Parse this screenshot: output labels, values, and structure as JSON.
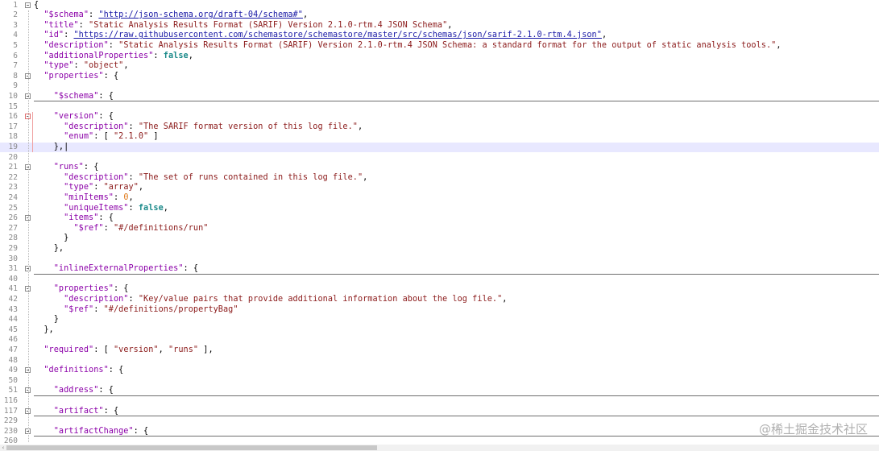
{
  "colors": {
    "key": "#8b00a8",
    "string": "#8b1a1a",
    "url": "#1a1aa6",
    "keyword": "#1b8a8a",
    "number": "#e07a1b",
    "current_line": "#e8e8ff"
  },
  "lines": [
    {
      "num": "1",
      "fold": true,
      "parts": [
        [
          "p",
          "{"
        ]
      ]
    },
    {
      "num": "2",
      "parts": [
        [
          "p",
          "  "
        ],
        [
          "k",
          "\"$schema\""
        ],
        [
          "p",
          ": "
        ],
        [
          "u",
          "\"http://json-schema.org/draft-04/schema#\""
        ],
        [
          "p",
          ","
        ]
      ]
    },
    {
      "num": "3",
      "parts": [
        [
          "p",
          "  "
        ],
        [
          "k",
          "\"title\""
        ],
        [
          "p",
          ": "
        ],
        [
          "s",
          "\"Static Analysis Results Format (SARIF) Version 2.1.0-rtm.4 JSON Schema\""
        ],
        [
          "p",
          ","
        ]
      ]
    },
    {
      "num": "4",
      "parts": [
        [
          "p",
          "  "
        ],
        [
          "k",
          "\"id\""
        ],
        [
          "p",
          ": "
        ],
        [
          "u",
          "\"https://raw.githubusercontent.com/schemastore/schemastore/master/src/schemas/json/sarif-2.1.0-rtm.4.json\""
        ],
        [
          "p",
          ","
        ]
      ]
    },
    {
      "num": "5",
      "parts": [
        [
          "p",
          "  "
        ],
        [
          "k",
          "\"description\""
        ],
        [
          "p",
          ": "
        ],
        [
          "s",
          "\"Static Analysis Results Format (SARIF) Version 2.1.0-rtm.4 JSON Schema: a standard format for the output of static analysis tools.\""
        ],
        [
          "p",
          ","
        ]
      ]
    },
    {
      "num": "6",
      "parts": [
        [
          "p",
          "  "
        ],
        [
          "k",
          "\"additionalProperties\""
        ],
        [
          "p",
          ": "
        ],
        [
          "b",
          "false"
        ],
        [
          "p",
          ","
        ]
      ]
    },
    {
      "num": "7",
      "parts": [
        [
          "p",
          "  "
        ],
        [
          "k",
          "\"type\""
        ],
        [
          "p",
          ": "
        ],
        [
          "s",
          "\"object\""
        ],
        [
          "p",
          ","
        ]
      ]
    },
    {
      "num": "8",
      "fold": true,
      "parts": [
        [
          "p",
          "  "
        ],
        [
          "k",
          "\"properties\""
        ],
        [
          "p",
          ": {"
        ]
      ]
    },
    {
      "num": "9",
      "parts": []
    },
    {
      "num": "10",
      "fold": true,
      "collapsed": true,
      "parts": [
        [
          "p",
          "    "
        ],
        [
          "k",
          "\"$schema\""
        ],
        [
          "p",
          ": {"
        ]
      ]
    },
    {
      "num": "15",
      "parts": []
    },
    {
      "num": "16",
      "fold": true,
      "mod": true,
      "parts": [
        [
          "p",
          "    "
        ],
        [
          "k",
          "\"version\""
        ],
        [
          "p",
          ": {"
        ]
      ]
    },
    {
      "num": "17",
      "parts": [
        [
          "p",
          "      "
        ],
        [
          "k",
          "\"description\""
        ],
        [
          "p",
          ": "
        ],
        [
          "s",
          "\"The SARIF format version of this log file.\""
        ],
        [
          "p",
          ","
        ]
      ]
    },
    {
      "num": "18",
      "parts": [
        [
          "p",
          "      "
        ],
        [
          "k",
          "\"enum\""
        ],
        [
          "p",
          ": [ "
        ],
        [
          "s",
          "\"2.1.0\""
        ],
        [
          "p",
          " ]"
        ]
      ]
    },
    {
      "num": "19",
      "highlight": true,
      "parts": [
        [
          "p",
          "    },|"
        ]
      ]
    },
    {
      "num": "20",
      "parts": []
    },
    {
      "num": "21",
      "fold": true,
      "parts": [
        [
          "p",
          "    "
        ],
        [
          "k",
          "\"runs\""
        ],
        [
          "p",
          ": {"
        ]
      ]
    },
    {
      "num": "22",
      "parts": [
        [
          "p",
          "      "
        ],
        [
          "k",
          "\"description\""
        ],
        [
          "p",
          ": "
        ],
        [
          "s",
          "\"The set of runs contained in this log file.\""
        ],
        [
          "p",
          ","
        ]
      ]
    },
    {
      "num": "23",
      "parts": [
        [
          "p",
          "      "
        ],
        [
          "k",
          "\"type\""
        ],
        [
          "p",
          ": "
        ],
        [
          "s",
          "\"array\""
        ],
        [
          "p",
          ","
        ]
      ]
    },
    {
      "num": "24",
      "parts": [
        [
          "p",
          "      "
        ],
        [
          "k",
          "\"minItems\""
        ],
        [
          "p",
          ": "
        ],
        [
          "n",
          "0"
        ],
        [
          "p",
          ","
        ]
      ]
    },
    {
      "num": "25",
      "parts": [
        [
          "p",
          "      "
        ],
        [
          "k",
          "\"uniqueItems\""
        ],
        [
          "p",
          ": "
        ],
        [
          "b",
          "false"
        ],
        [
          "p",
          ","
        ]
      ]
    },
    {
      "num": "26",
      "fold": true,
      "parts": [
        [
          "p",
          "      "
        ],
        [
          "k",
          "\"items\""
        ],
        [
          "p",
          ": {"
        ]
      ]
    },
    {
      "num": "27",
      "parts": [
        [
          "p",
          "        "
        ],
        [
          "k",
          "\"$ref\""
        ],
        [
          "p",
          ": "
        ],
        [
          "s",
          "\"#/definitions/run\""
        ]
      ]
    },
    {
      "num": "28",
      "parts": [
        [
          "p",
          "      }"
        ]
      ]
    },
    {
      "num": "29",
      "parts": [
        [
          "p",
          "    },"
        ]
      ]
    },
    {
      "num": "30",
      "parts": []
    },
    {
      "num": "31",
      "fold": true,
      "collapsed": true,
      "parts": [
        [
          "p",
          "    "
        ],
        [
          "k",
          "\"inlineExternalProperties\""
        ],
        [
          "p",
          ": {"
        ]
      ]
    },
    {
      "num": "40",
      "parts": []
    },
    {
      "num": "41",
      "fold": true,
      "parts": [
        [
          "p",
          "    "
        ],
        [
          "k",
          "\"properties\""
        ],
        [
          "p",
          ": {"
        ]
      ]
    },
    {
      "num": "42",
      "parts": [
        [
          "p",
          "      "
        ],
        [
          "k",
          "\"description\""
        ],
        [
          "p",
          ": "
        ],
        [
          "s",
          "\"Key/value pairs that provide additional information about the log file.\""
        ],
        [
          "p",
          ","
        ]
      ]
    },
    {
      "num": "43",
      "parts": [
        [
          "p",
          "      "
        ],
        [
          "k",
          "\"$ref\""
        ],
        [
          "p",
          ": "
        ],
        [
          "s",
          "\"#/definitions/propertyBag\""
        ]
      ]
    },
    {
      "num": "44",
      "parts": [
        [
          "p",
          "    }"
        ]
      ]
    },
    {
      "num": "45",
      "parts": [
        [
          "p",
          "  },"
        ]
      ]
    },
    {
      "num": "46",
      "parts": []
    },
    {
      "num": "47",
      "parts": [
        [
          "p",
          "  "
        ],
        [
          "k",
          "\"required\""
        ],
        [
          "p",
          ": [ "
        ],
        [
          "s",
          "\"version\""
        ],
        [
          "p",
          ", "
        ],
        [
          "s",
          "\"runs\""
        ],
        [
          "p",
          " ],"
        ]
      ]
    },
    {
      "num": "48",
      "parts": []
    },
    {
      "num": "49",
      "fold": true,
      "parts": [
        [
          "p",
          "  "
        ],
        [
          "k",
          "\"definitions\""
        ],
        [
          "p",
          ": {"
        ]
      ]
    },
    {
      "num": "50",
      "parts": []
    },
    {
      "num": "51",
      "fold": true,
      "collapsed": true,
      "parts": [
        [
          "p",
          "    "
        ],
        [
          "k",
          "\"address\""
        ],
        [
          "p",
          ": {"
        ]
      ]
    },
    {
      "num": "116",
      "parts": []
    },
    {
      "num": "117",
      "fold": true,
      "collapsed": true,
      "parts": [
        [
          "p",
          "    "
        ],
        [
          "k",
          "\"artifact\""
        ],
        [
          "p",
          ": {"
        ]
      ]
    },
    {
      "num": "229",
      "parts": []
    },
    {
      "num": "230",
      "fold": true,
      "collapsed": true,
      "parts": [
        [
          "p",
          "    "
        ],
        [
          "k",
          "\"artifactChange\""
        ],
        [
          "p",
          ": {"
        ]
      ]
    },
    {
      "num": "260",
      "parts": []
    }
  ],
  "watermark": "@稀土掘金技术社区"
}
